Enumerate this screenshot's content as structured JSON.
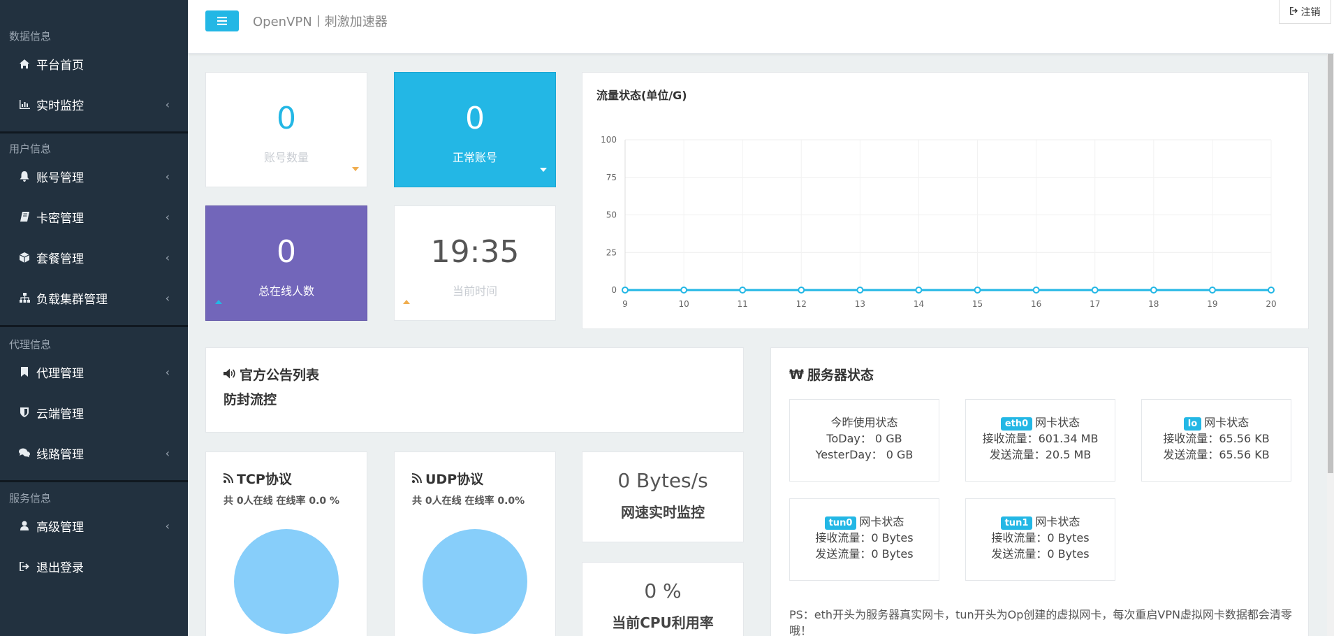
{
  "app": {
    "title": "OpenVPN丨刺激加速器",
    "logout_label": "注销"
  },
  "sidebar": {
    "sections": [
      {
        "header": "数据信息",
        "items": [
          {
            "label": "平台首页",
            "icon": "home-icon",
            "chevron": false
          },
          {
            "label": "实时监控",
            "icon": "bar-chart-icon",
            "chevron": true
          }
        ]
      },
      {
        "header": "用户信息",
        "items": [
          {
            "label": "账号管理",
            "icon": "bell-icon",
            "chevron": true
          },
          {
            "label": "卡密管理",
            "icon": "book-icon",
            "chevron": true
          },
          {
            "label": "套餐管理",
            "icon": "cube-icon",
            "chevron": true
          },
          {
            "label": "负载集群管理",
            "icon": "sitemap-icon",
            "chevron": true
          }
        ]
      },
      {
        "header": "代理信息",
        "items": [
          {
            "label": "代理管理",
            "icon": "bookmark-icon",
            "chevron": true
          },
          {
            "label": "云端管理",
            "icon": "shield-icon",
            "chevron": false
          },
          {
            "label": "线路管理",
            "icon": "comments-icon",
            "chevron": true
          }
        ]
      },
      {
        "header": "服务信息",
        "items": [
          {
            "label": "高级管理",
            "icon": "user-icon",
            "chevron": true
          },
          {
            "label": "退出登录",
            "icon": "sign-out-icon",
            "chevron": false
          }
        ]
      }
    ]
  },
  "stats": {
    "accounts": {
      "value": "0",
      "label": "账号数量"
    },
    "normal": {
      "value": "0",
      "label": "正常账号"
    },
    "online": {
      "value": "0",
      "label": "总在线人数"
    },
    "time": {
      "value": "19:35",
      "label": "当前时间"
    }
  },
  "colors": {
    "accent": "#23b7e5",
    "purple": "#7266ba",
    "sidebar": "#22313f",
    "pie": "#87cefa",
    "warning": "#f0ad4e"
  },
  "traffic": {
    "title": "流量状态(单位/G)"
  },
  "chart_data": {
    "type": "line",
    "title": "流量状态(单位/G)",
    "x": [
      9,
      10,
      11,
      12,
      13,
      14,
      15,
      16,
      17,
      18,
      19,
      20
    ],
    "series": [
      {
        "values": [
          0,
          0,
          0,
          0,
          0,
          0,
          0,
          0,
          0,
          0,
          0,
          0
        ]
      }
    ],
    "ylim": [
      0,
      100
    ],
    "yticks": [
      0,
      25,
      50,
      75,
      100
    ],
    "grid": true
  },
  "announce": {
    "title": "官方公告列表",
    "content": "防封流控"
  },
  "tcp": {
    "title": "TCP协议",
    "stats": "共 0人在线 在线率 0.0 %"
  },
  "udp": {
    "title": "UDP协议",
    "stats": "共 0人在线 在线率 0.0%"
  },
  "speed": {
    "value": "0 Bytes/s",
    "label": "网速实时监控"
  },
  "cpu": {
    "value": "0 %",
    "label": "当前CPU利用率"
  },
  "server": {
    "title": "服务器状态",
    "icon_glyph": "₩",
    "usage": {
      "title": "今昨使用状态",
      "today": "ToDay： 0 GB",
      "yesterday": "YesterDay： 0 GB"
    },
    "nics": [
      {
        "name": "eth0",
        "suffix": "网卡状态",
        "rx": "接收流量：601.34 MB",
        "tx": "发送流量：20.5 MB"
      },
      {
        "name": "lo",
        "suffix": "网卡状态",
        "rx": "接收流量：65.56 KB",
        "tx": "发送流量：65.56 KB"
      },
      {
        "name": "tun0",
        "suffix": "网卡状态",
        "rx": "接收流量：0 Bytes",
        "tx": "发送流量：0 Bytes"
      },
      {
        "name": "tun1",
        "suffix": "网卡状态",
        "rx": "接收流量：0 Bytes",
        "tx": "发送流量：0 Bytes"
      }
    ],
    "note": "PS：eth开头为服务器真实网卡，tun开头为Op创建的虚拟网卡，每次重启VPN虚拟网卡数据都会清零哦！"
  }
}
